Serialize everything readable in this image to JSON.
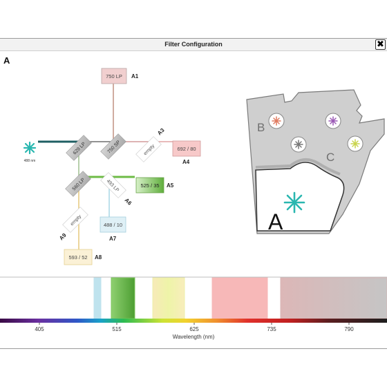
{
  "window": {
    "title": "Filter Configuration",
    "close_glyph": "✖"
  },
  "panel_label": "A",
  "light_path": {
    "laser_label": "488 nm",
    "dichroics": [
      "629 LP",
      "750 SP",
      "empty",
      "560 LP",
      "493 LP",
      "empty"
    ],
    "filters": [
      "750 LP",
      "692 / 80",
      "525 / 35",
      "488 / 10",
      "593 / 52"
    ],
    "slot_labels": [
      "A1",
      "A3",
      "A4",
      "A5",
      "A6",
      "A7",
      "A8",
      "A9"
    ]
  },
  "turret": {
    "zone_labels": [
      "B",
      "C",
      "A"
    ],
    "colors": {
      "orange": "#e07a5f",
      "purple": "#9b59b6",
      "gray": "#888888",
      "yellow": "#c8d44a",
      "teal": "#2ab7b0"
    }
  },
  "spectrum": {
    "ticks": [
      "405",
      "515",
      "625",
      "735",
      "790"
    ],
    "xlabel": "Wavelength (nm)",
    "bands": [
      {
        "name": "488 / 10",
        "color": "#bfe3ee"
      },
      {
        "name": "525 / 35",
        "color": "#7cc45c"
      },
      {
        "name": "593 / 52",
        "color": "#eef0a8"
      },
      {
        "name": "692 / 80",
        "color": "#f7b8b8"
      },
      {
        "name": "750 LP",
        "color": "#d8b6b6"
      }
    ]
  }
}
